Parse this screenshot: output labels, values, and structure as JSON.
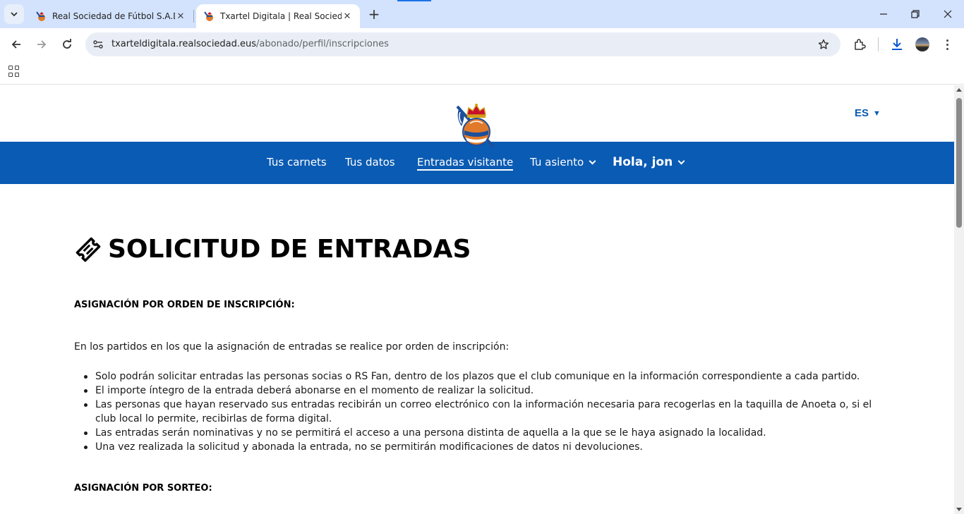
{
  "browser": {
    "tabs": [
      {
        "title": "Real Sociedad de Fútbol S.A.D.",
        "active": false
      },
      {
        "title": "Txartel Digitala | Real Sociedad",
        "active": true
      }
    ],
    "url_host": "txarteldigitala.realsociedad.eus",
    "url_path": "/abonado/perfil/inscripciones"
  },
  "site": {
    "language": "ES",
    "nav": [
      {
        "label": "Tus carnets"
      },
      {
        "label": "Tus datos"
      },
      {
        "label": "Entradas visitante",
        "active": true
      },
      {
        "label": "Tu asiento"
      },
      {
        "label": "Hola, jon"
      }
    ]
  },
  "page": {
    "title": "SOLICITUD DE ENTRADAS",
    "section1_heading": "ASIGNACIÓN POR ORDEN DE INSCRIPCIÓN:",
    "section1_intro": "En los partidos en los que la asignación de entradas se realice por orden de inscripción:",
    "section1_bullets": [
      "Solo podrán solicitar entradas las personas socias o RS Fan, dentro de los plazos que el club comunique en la información correspondiente a cada partido.",
      "El importe íntegro de la entrada deberá abonarse en el momento de realizar la solicitud.",
      "Las personas que hayan reservado sus entradas recibirán un correo electrónico con la información necesaria para recogerlas en la taquilla de Anoeta o, si el club local lo permite, recibirlas de forma digital.",
      "Las entradas serán nominativas y no se permitirá el acceso a una persona distinta de aquella a la que se le haya asignado la localidad.",
      "Una vez realizada la solicitud y abonada la entrada, no se permitirán modificaciones de datos ni devoluciones."
    ],
    "section2_heading": "ASIGNACIÓN POR SORTEO:"
  },
  "colors": {
    "brand_blue": "#0a5bb3",
    "tabstrip": "#d3e3fd"
  },
  "icons": [
    "tab-search-icon",
    "back-arrow-icon",
    "forward-arrow-icon",
    "reload-icon",
    "site-info-icon",
    "bookmark-star-icon",
    "extensions-icon",
    "download-icon",
    "profile-avatar",
    "menu-dots-icon",
    "apps-grid-icon",
    "club-crest-logo",
    "ticket-icon"
  ]
}
